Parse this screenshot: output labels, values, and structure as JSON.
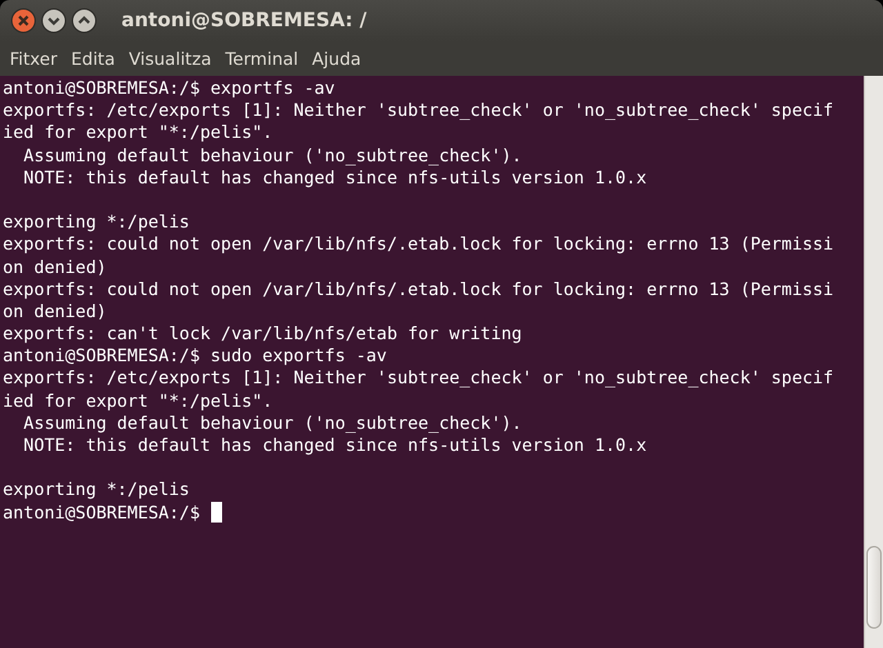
{
  "window": {
    "title": "antoni@SOBREMESA: /"
  },
  "menu": [
    "Fitxer",
    "Edita",
    "Visualitza",
    "Terminal",
    "Ajuda"
  ],
  "terminal": {
    "lines": [
      {
        "kind": "text",
        "text": "antoni@SOBREMESA:/$ exportfs -av"
      },
      {
        "kind": "text",
        "text": "exportfs: /etc/exports [1]: Neither 'subtree_check' or 'no_subtree_check' specif"
      },
      {
        "kind": "text",
        "text": "ied for export \"*:/pelis\"."
      },
      {
        "kind": "text",
        "text": "  Assuming default behaviour ('no_subtree_check')."
      },
      {
        "kind": "text",
        "text": "  NOTE: this default has changed since nfs-utils version 1.0.x"
      },
      {
        "kind": "blank"
      },
      {
        "kind": "text",
        "text": "exporting *:/pelis"
      },
      {
        "kind": "text",
        "text": "exportfs: could not open /var/lib/nfs/.etab.lock for locking: errno 13 (Permissi"
      },
      {
        "kind": "text",
        "text": "on denied)"
      },
      {
        "kind": "text",
        "text": "exportfs: could not open /var/lib/nfs/.etab.lock for locking: errno 13 (Permissi"
      },
      {
        "kind": "text",
        "text": "on denied)"
      },
      {
        "kind": "text",
        "text": "exportfs: can't lock /var/lib/nfs/etab for writing"
      },
      {
        "kind": "text",
        "text": "antoni@SOBREMESA:/$ sudo exportfs -av"
      },
      {
        "kind": "text",
        "text": "exportfs: /etc/exports [1]: Neither 'subtree_check' or 'no_subtree_check' specif"
      },
      {
        "kind": "text",
        "text": "ied for export \"*:/pelis\"."
      },
      {
        "kind": "text",
        "text": "  Assuming default behaviour ('no_subtree_check')."
      },
      {
        "kind": "text",
        "text": "  NOTE: this default has changed since nfs-utils version 1.0.x"
      },
      {
        "kind": "blank"
      },
      {
        "kind": "text",
        "text": "exporting *:/pelis"
      },
      {
        "kind": "prompt",
        "text": "antoni@SOBREMESA:/$ "
      }
    ]
  }
}
